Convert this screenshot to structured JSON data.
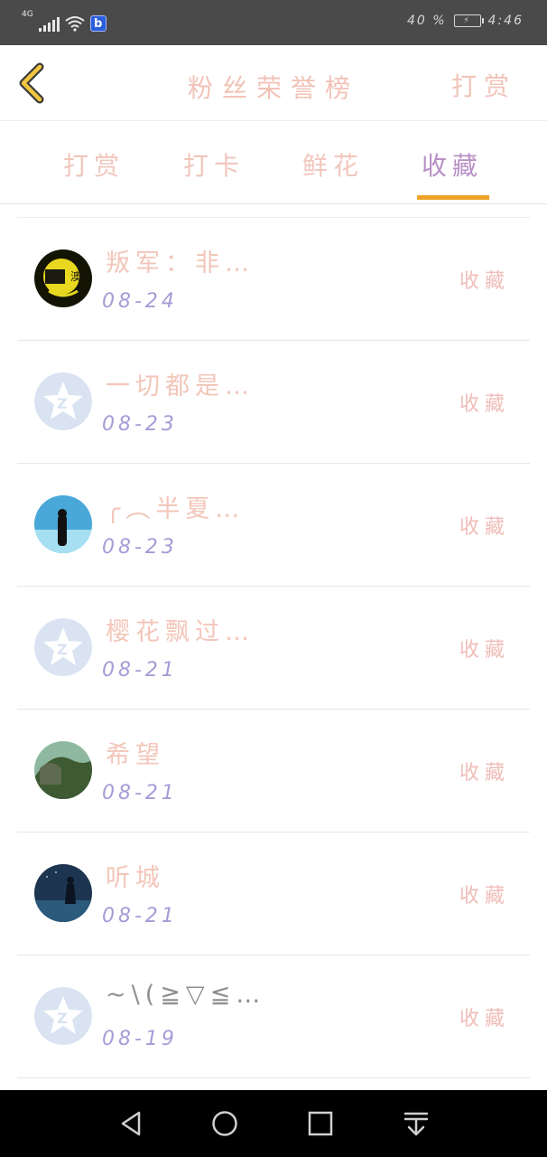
{
  "status_bar": {
    "network": "4G",
    "battery_level": "40 %",
    "time": "4:46",
    "app_badge": "b"
  },
  "header": {
    "title": "粉丝荣誉榜",
    "right_link": "打赏",
    "back_icon": "chevron-left-icon"
  },
  "tabs": [
    {
      "label": "打赏",
      "active": false
    },
    {
      "label": "打卡",
      "active": false
    },
    {
      "label": "鲜花",
      "active": false
    },
    {
      "label": "收藏",
      "active": true
    }
  ],
  "rows": [
    {
      "name": "叛军：非…",
      "date": "08-24",
      "action": "收藏",
      "avatar": "photo-avatar"
    },
    {
      "name": "一切都是…",
      "date": "08-23",
      "action": "收藏",
      "avatar": "default-star-avatar"
    },
    {
      "name": "╭︵半夏…",
      "date": "08-23",
      "action": "收藏",
      "avatar": "photo-avatar"
    },
    {
      "name": "樱花飘过…",
      "date": "08-21",
      "action": "收藏",
      "avatar": "default-star-avatar"
    },
    {
      "name": "希望",
      "date": "08-21",
      "action": "收藏",
      "avatar": "photo-avatar"
    },
    {
      "name": "听城",
      "date": "08-21",
      "action": "收藏",
      "avatar": "photo-avatar"
    },
    {
      "name": "~\\(≧▽≦…",
      "date": "08-19",
      "action": "收藏",
      "avatar": "default-star-avatar"
    }
  ],
  "colors": {
    "accent_underline": "#f0a128",
    "active_tab": "#b790c6",
    "inactive_text": "#f1c6bd",
    "date_text": "#a79bd6",
    "status_bar_bg": "#4a4a4a",
    "nav_bar_bg": "#000000"
  },
  "nav_icons": [
    "back-triangle-icon",
    "home-circle-icon",
    "recents-square-icon",
    "notification-pull-icon"
  ]
}
